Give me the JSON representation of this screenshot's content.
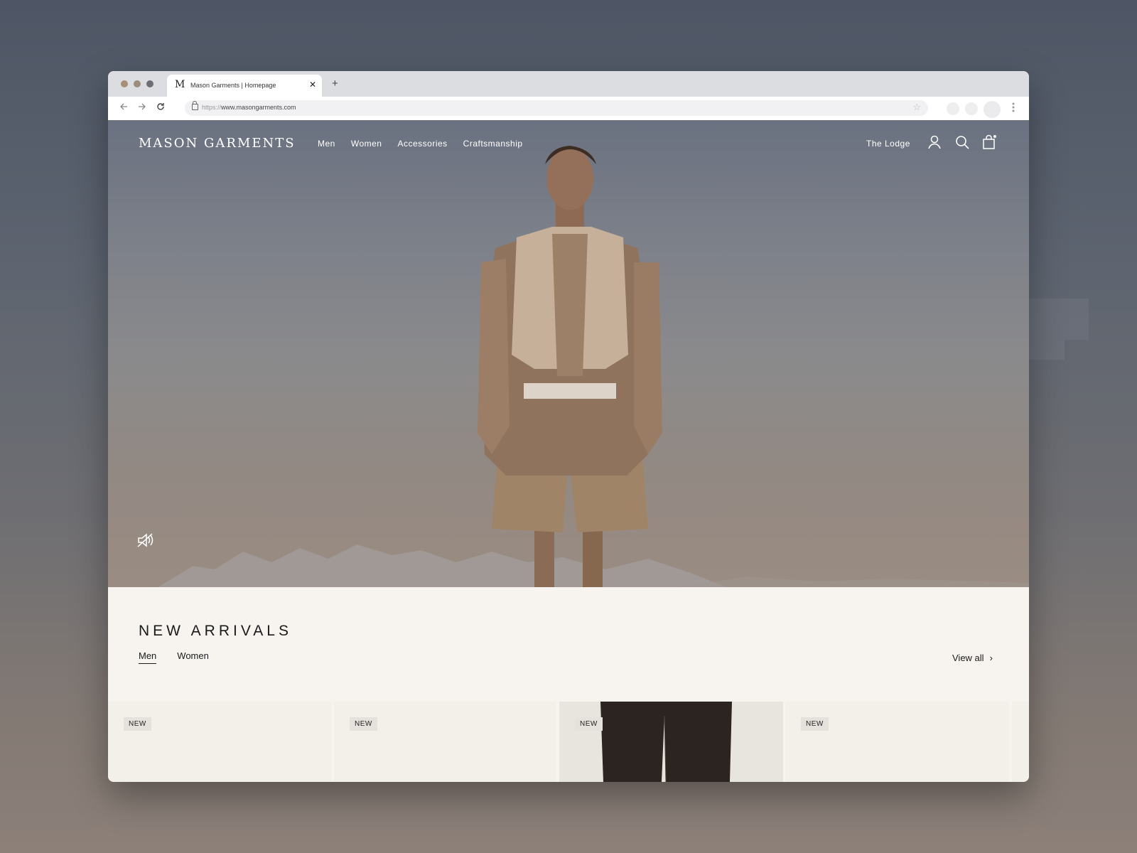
{
  "browser": {
    "tab_title": "Mason Garments | Homepage",
    "favicon": "M",
    "tab_close": "✕",
    "new_tab": "+",
    "url_scheme": "https://",
    "url_host": "www.masongarments.com",
    "icons": [
      "back-arrow-icon",
      "forward-arrow-icon",
      "reload-icon",
      "lock-icon",
      "star-icon",
      "kebab-menu-icon"
    ]
  },
  "header": {
    "logo": "MASON GARMENTS",
    "nav": [
      "Men",
      "Women",
      "Accessories",
      "Craftsmanship"
    ],
    "lodge": "The Lodge",
    "icons": [
      "user-icon",
      "search-icon",
      "shopping-bag-icon"
    ]
  },
  "hero": {
    "mute_icon": "speaker-muted-icon"
  },
  "new_arrivals": {
    "title": "NEW ARRIVALS",
    "tabs": [
      "Men",
      "Women"
    ],
    "active_tab": "Men",
    "view_all": "View all",
    "chevron": "›",
    "cards": [
      {
        "badge": "NEW"
      },
      {
        "badge": "NEW"
      },
      {
        "badge": "NEW"
      },
      {
        "badge": "NEW"
      }
    ]
  },
  "colors": {
    "page_background": "#5d6470",
    "section_background": "#f7f4ef",
    "card_background": "#f3efe9",
    "text": "#1a1a1a"
  }
}
